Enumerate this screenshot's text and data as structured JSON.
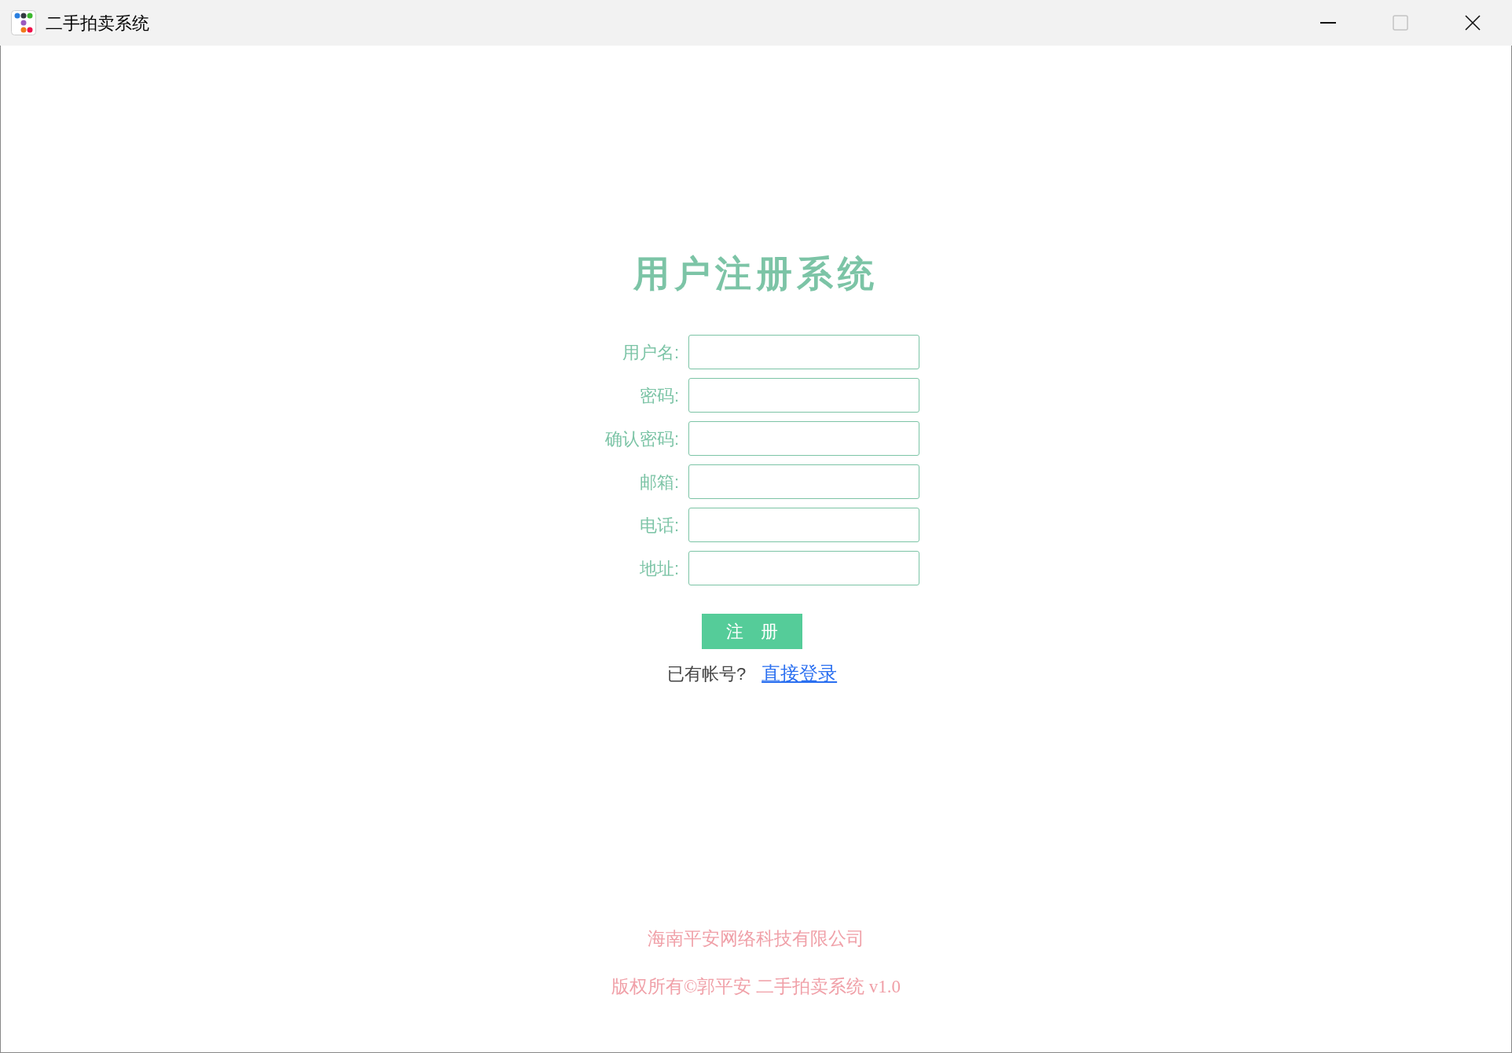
{
  "window": {
    "title": "二手拍卖系统"
  },
  "heading": "用户注册系统",
  "fields": [
    {
      "label": "用户名:"
    },
    {
      "label": "密码:"
    },
    {
      "label": "确认密码:"
    },
    {
      "label": "邮箱:"
    },
    {
      "label": "电话:"
    },
    {
      "label": "地址:"
    }
  ],
  "register_button": "注　册",
  "login_prompt": "已有帐号?",
  "login_link": "直接登录",
  "footer": [
    "海南平安网络科技有限公司",
    "版权所有©郭平安 二手拍卖系统 v1.0"
  ]
}
